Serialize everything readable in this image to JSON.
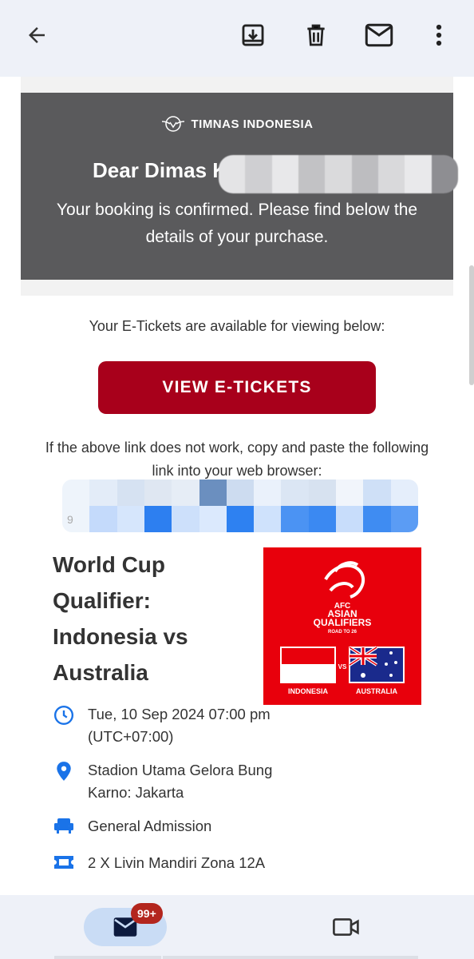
{
  "toolbar": {
    "back_icon": "arrow-left-icon",
    "archive_icon": "archive-icon",
    "delete_icon": "trash-icon",
    "mark_unread_icon": "mail-icon",
    "more_icon": "more-vert-icon"
  },
  "email": {
    "brand_name": "TIMNAS INDONESIA",
    "greeting": "Dear Dimas K",
    "confirmation": "Your booking is confirmed. Please find below the details of your purchase.",
    "tickets_available": "Your E-Tickets are available for viewing below:",
    "view_button": "VIEW E-TICKETS",
    "fallback_text": "If the above link does not work, copy and paste the following link into your web browser:",
    "redacted_link_prefix": "9",
    "event": {
      "title": "World Cup Qualifier: Indonesia vs Australia",
      "image": {
        "line1": "AFC",
        "line2": "ASIAN",
        "line3": "QUALIFIERS",
        "line4": "ROAD TO 26",
        "vs": "VS",
        "team1": "INDONESIA",
        "team2": "AUSTRALIA"
      },
      "date_time": "Tue, 10 Sep 2024 07:00 pm (UTC+07:00)",
      "venue": "Stadion Utama Gelora Bung Karno: Jakarta",
      "admission": "General Admission",
      "tickets": "2 X Livin Mandiri Zona 12A"
    }
  },
  "bottom_nav": {
    "mail_badge": "99+",
    "mail_icon": "mail-icon",
    "video_icon": "video-icon"
  },
  "colors": {
    "banner": "#5a5a5c",
    "button": "#a8001b",
    "accent_blue": "#1a73e8",
    "afc_red": "#e8000c"
  }
}
